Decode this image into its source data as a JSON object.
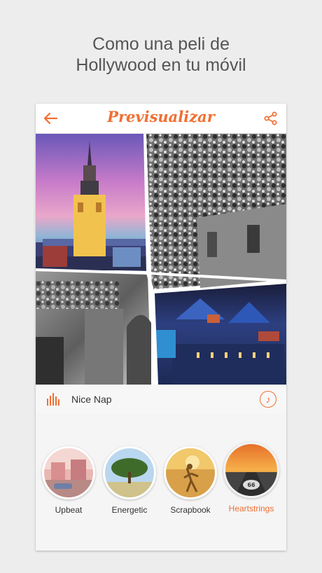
{
  "promo": {
    "line1": "Como una peli de",
    "line2": "Hollywood en tu móvil"
  },
  "header": {
    "title": "Previsualizar",
    "back_icon": "arrow-left-icon",
    "share_icon": "share-icon"
  },
  "music": {
    "track": "Nice Nap",
    "eq_icon": "equalizer-icon",
    "music_icon": "music-note-icon"
  },
  "themes": [
    {
      "label": "Upbeat",
      "selected": false
    },
    {
      "label": "Energetic",
      "selected": false
    },
    {
      "label": "Scrapbook",
      "selected": false
    },
    {
      "label": "Heartstrings",
      "selected": true
    }
  ],
  "colors": {
    "accent": "#f06f32",
    "background": "#ededed"
  }
}
